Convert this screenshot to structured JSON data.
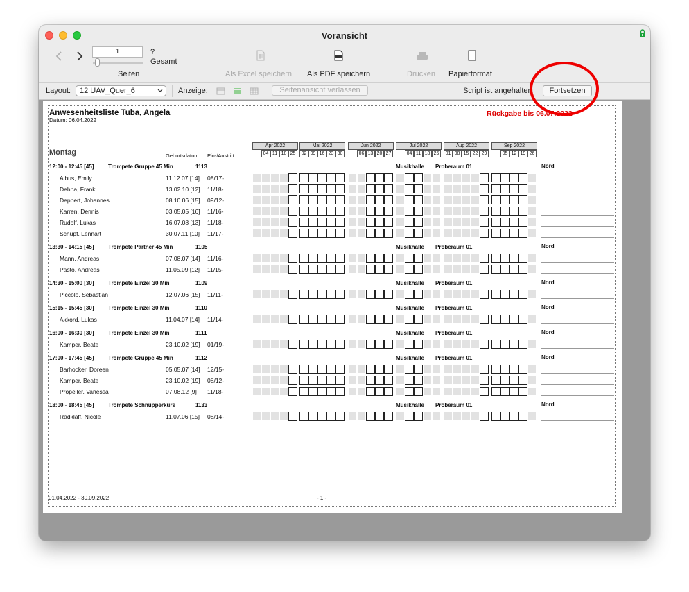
{
  "window": {
    "title": "Voransicht"
  },
  "toolbar": {
    "page_input": "1",
    "page_total": "?",
    "gesamt": "Gesamt",
    "seiten": "Seiten",
    "excel": "Als Excel speichern",
    "pdf": "Als PDF speichern",
    "print": "Drucken",
    "paper": "Papierformat"
  },
  "layoutbar": {
    "layout_label": "Layout:",
    "layout_value": "12 UAV_Quer_6",
    "anzeige": "Anzeige:",
    "exit_preview": "Seitenansicht verlassen",
    "script_status": "Script ist angehalten",
    "continue": "Fortsetzen"
  },
  "colors": {
    "return_red": "#dd0000",
    "annotation_circle": "#ee0000"
  },
  "report": {
    "title": "Anwesenheitsliste Tuba, Angela",
    "date": "Datum: 06.04.2022",
    "return_notice": "Rückgabe bis 06.07.2022",
    "day": "Montag",
    "col_birth": "Geburtsdatum",
    "col_inout": "Ein-/Austritt",
    "months": [
      {
        "name": "Apr 2022",
        "days": [
          "04",
          "11",
          "18",
          "25"
        ]
      },
      {
        "name": "Mai 2022",
        "days": [
          "02",
          "09",
          "16",
          "23",
          "30"
        ]
      },
      {
        "name": "Jun 2022",
        "days": [
          "06",
          "13",
          "20",
          "27"
        ]
      },
      {
        "name": "Jul 2022",
        "days": [
          "04",
          "11",
          "18",
          "25"
        ]
      },
      {
        "name": "Aug 2022",
        "days": [
          "01",
          "08",
          "15",
          "22",
          "29"
        ]
      },
      {
        "name": "Sep 2022",
        "days": [
          "05",
          "12",
          "19",
          "26"
        ]
      }
    ],
    "groups": [
      {
        "time": "12:00 - 12:45 [45]",
        "course": "Trompete Gruppe 45 Min",
        "id": "1113",
        "place": "Musikhalle",
        "room": "Proberaum 01",
        "region": "Nord",
        "students": [
          {
            "name": "Albus, Emily",
            "birth": "11.12.07 [14]",
            "inout": "08/17-"
          },
          {
            "name": "Dehna, Frank",
            "birth": "13.02.10 [12]",
            "inout": "11/18-"
          },
          {
            "name": "Deppert, Johannes",
            "birth": "08.10.06 [15]",
            "inout": "09/12-"
          },
          {
            "name": "Karren, Dennis",
            "birth": "03.05.05 [16]",
            "inout": "11/16-"
          },
          {
            "name": "Rudolf, Lukas",
            "birth": "16.07.08 [13]",
            "inout": "11/18-"
          },
          {
            "name": "Schupf, Lennart",
            "birth": "30.07.11 [10]",
            "inout": "11/17-"
          }
        ]
      },
      {
        "time": "13:30 - 14:15 [45]",
        "course": "Trompete Partner 45 Min",
        "id": "1105",
        "place": "Musikhalle",
        "room": "Proberaum 01",
        "region": "Nord",
        "students": [
          {
            "name": "Mann, Andreas",
            "birth": "07.08.07 [14]",
            "inout": "11/16-"
          },
          {
            "name": "Pasto, Andreas",
            "birth": "11.05.09 [12]",
            "inout": "11/15-"
          }
        ]
      },
      {
        "time": "14:30 - 15:00 [30]",
        "course": "Trompete Einzel 30 Min",
        "id": "1109",
        "place": "Musikhalle",
        "room": "Proberaum 01",
        "region": "Nord",
        "students": [
          {
            "name": "Piccolo, Sebastian",
            "birth": "12.07.06 [15]",
            "inout": "11/11-"
          }
        ]
      },
      {
        "time": "15:15 - 15:45 [30]",
        "course": "Trompete Einzel 30 Min",
        "id": "1110",
        "place": "Musikhalle",
        "room": "Proberaum 01",
        "region": "Nord",
        "students": [
          {
            "name": "Akkord, Lukas",
            "birth": "11.04.07 [14]",
            "inout": "11/14-"
          }
        ]
      },
      {
        "time": "16:00 - 16:30 [30]",
        "course": "Trompete Einzel 30 Min",
        "id": "1111",
        "place": "Musikhalle",
        "room": "Proberaum 01",
        "region": "Nord",
        "students": [
          {
            "name": "Kamper, Beate",
            "birth": "23.10.02 [19]",
            "inout": "01/19-"
          }
        ]
      },
      {
        "time": "17:00 - 17:45 [45]",
        "course": "Trompete Gruppe 45 Min",
        "id": "1112",
        "place": "Musikhalle",
        "room": "Proberaum 01",
        "region": "Nord",
        "students": [
          {
            "name": "Barhocker, Doreen",
            "birth": "05.05.07 [14]",
            "inout": "12/15-"
          },
          {
            "name": "Kamper, Beate",
            "birth": "23.10.02 [19]",
            "inout": "08/12-"
          },
          {
            "name": "Propeller, Vanessa",
            "birth": "07.08.12 [9]",
            "inout": "11/18-"
          }
        ]
      },
      {
        "time": "18:00 - 18:45 [45]",
        "course": "Trompete Schnupperkurs",
        "id": "1133",
        "place": "Musikhalle",
        "room": "Proberaum 01",
        "region": "Nord",
        "students": [
          {
            "name": "Radklaff, Nicole",
            "birth": "11.07.06 [15]",
            "inout": "08/14-"
          }
        ]
      }
    ],
    "footer_range": "01.04.2022  - 30.09.2022",
    "page_number": "- 1 -"
  }
}
